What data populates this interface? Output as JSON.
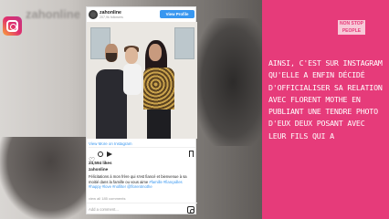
{
  "background": {
    "ghost_text": "zahonline"
  },
  "badge": {
    "line1": "NON STOP",
    "line2": "PEOPLE"
  },
  "caption": {
    "text": "Ainsi, c'est sur Instagram qu'elle a enfin décidé d'officialiser sa relation avec Florent Mothe en publiant une tendre photo d'eux deux posant avec leur fils qui a"
  },
  "post": {
    "username": "zahonline",
    "followers": "207,9k followers",
    "view_profile_label": "View Profile",
    "view_more_label": "View More on Instagram",
    "likes": "24,594 likes",
    "author": "zahonline",
    "body": "Félicitations à mon frère qui s'est fiancé et bienvenue à sa moitié dans la famille ou vous aime",
    "hashtags": "#famille #fiançailles #happy #love #nofilter @florentmothe",
    "comments_link": "view all 185 comments",
    "add_comment_placeholder": "Add a comment..."
  },
  "colors": {
    "pink_panel": "#e63b7a",
    "link_blue": "#3897f0"
  },
  "icons": {
    "instagram_app": "instagram-icon",
    "like": "heart-icon",
    "comment": "comment-icon",
    "share": "share-icon",
    "save": "bookmark-icon",
    "footer": "instagram-small-icon"
  }
}
